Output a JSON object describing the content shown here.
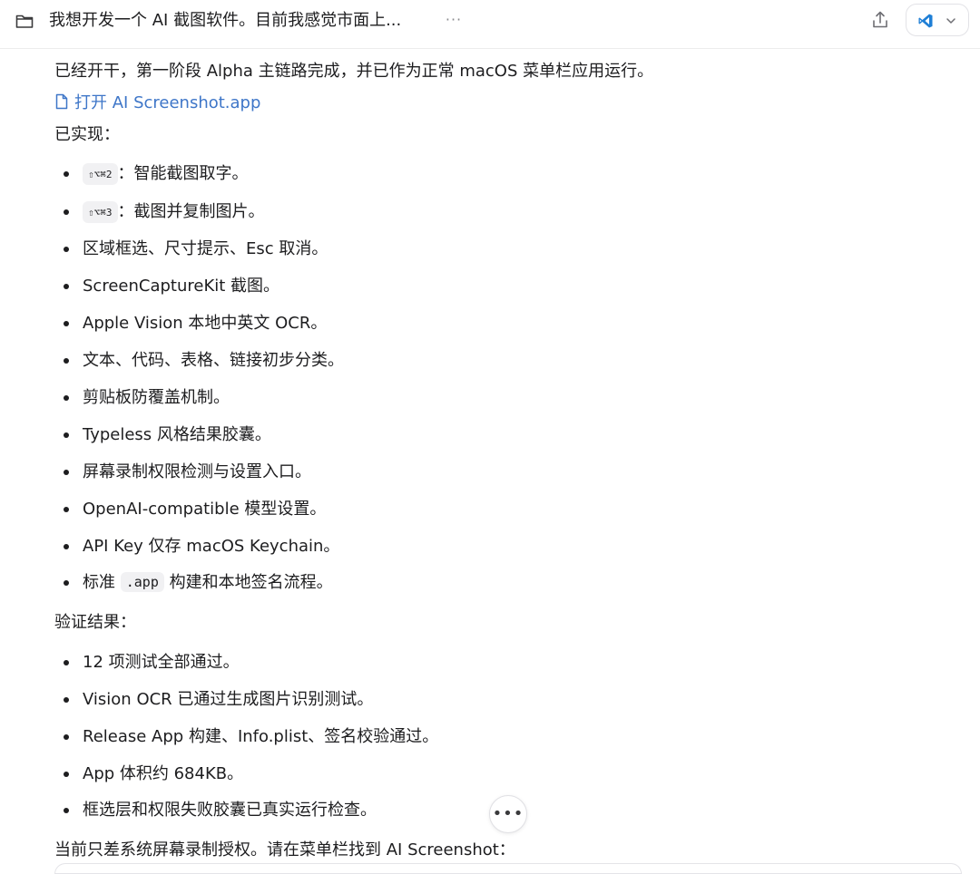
{
  "header": {
    "title": "我想开发一个 AI 截图软件。目前我感觉市面上...",
    "more_label": "···"
  },
  "message": {
    "intro": "已经开干，第一阶段 Alpha 主链路完成，并已作为正常 macOS 菜单栏应用运行。",
    "open_link": "打开 AI Screenshot.app",
    "implemented_heading": "已实现：",
    "implemented": [
      {
        "code": "⇧⌥⌘2",
        "text": "：智能截图取字。"
      },
      {
        "code": "⇧⌥⌘3",
        "text": "：截图并复制图片。"
      },
      {
        "text": "区域框选、尺寸提示、Esc 取消。"
      },
      {
        "text": "ScreenCaptureKit 截图。"
      },
      {
        "text": "Apple Vision 本地中英文 OCR。"
      },
      {
        "text": "文本、代码、表格、链接初步分类。"
      },
      {
        "text": "剪贴板防覆盖机制。"
      },
      {
        "text": "Typeless 风格结果胶囊。"
      },
      {
        "text": "屏幕录制权限检测与设置入口。"
      },
      {
        "text": "OpenAI-compatible 模型设置。"
      },
      {
        "text": "API Key 仅存 macOS Keychain。"
      },
      {
        "prefix": "标准 ",
        "code": ".app",
        "text": " 构建和本地签名流程。"
      }
    ],
    "verification_heading": "验证结果：",
    "verification": [
      "12 项测试全部通过。",
      "Vision OCR 已通过生成图片识别测试。",
      "Release App 构建、Info.plist、签名校验通过。",
      "App 体积约 684KB。",
      "框选层和权限失败胶囊已真实运行检查。"
    ],
    "closing": "当前只差系统屏幕录制授权。请在菜单栏找到 AI Screenshot："
  },
  "floating": {
    "more_label": "•••"
  },
  "icons": {
    "folder": "folder-icon",
    "share": "share-icon",
    "editor": "vscode-icon",
    "chevron": "chevron-down-icon",
    "document": "document-icon"
  },
  "colors": {
    "link": "#3e76c8",
    "text": "#1d1d1f",
    "code_bg": "#f1f1f3",
    "vscode_blue": "#1f7fd6"
  }
}
